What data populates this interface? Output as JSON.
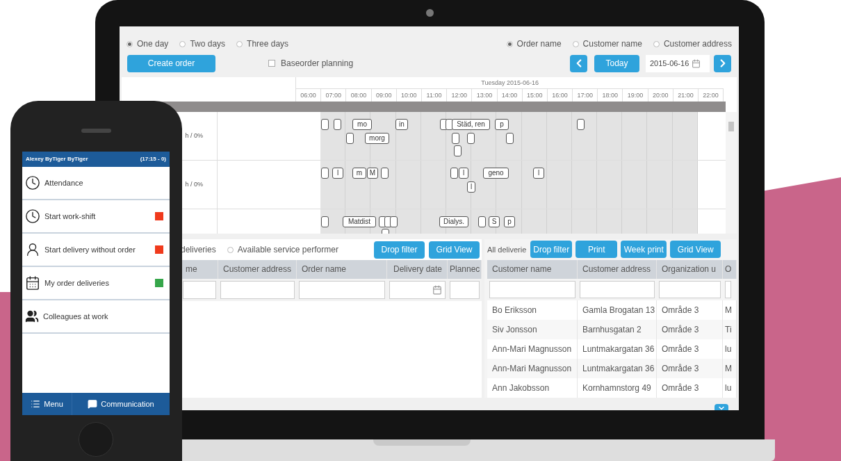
{
  "phone": {
    "header": {
      "user": "Alexey ByTiger ByTiger",
      "shift": "(17:15 - 0)"
    },
    "items": [
      {
        "kind": "clock",
        "label": "Attendance"
      },
      {
        "kind": "clock",
        "label": "Start work-shift",
        "color": "#f03a1c"
      },
      {
        "kind": "person",
        "label": "Start delivery without order",
        "color": "#f03a1c"
      },
      {
        "kind": "calendar",
        "label": "My order deliveries",
        "color": "#36a64a"
      },
      {
        "kind": "people",
        "label": "Colleagues at work"
      }
    ],
    "footer": [
      {
        "kind": "menu",
        "label": "Menu"
      },
      {
        "kind": "chat",
        "label": "Communication"
      }
    ]
  },
  "planner": {
    "view_options": [
      {
        "label": "One day",
        "selected": true
      },
      {
        "label": "Two days",
        "selected": false
      },
      {
        "label": "Three days",
        "selected": false
      }
    ],
    "search_by": [
      {
        "label": "Order name",
        "selected": true
      },
      {
        "label": "Customer name",
        "selected": false
      },
      {
        "label": "Customer address",
        "selected": false
      }
    ],
    "create_button": "Create order",
    "baseorder": {
      "label": "Baseorder planning",
      "checked": false
    },
    "today_button": "Today",
    "date_field": "2015-06-16",
    "timeline": {
      "date": "Tuesday 2015-06-16",
      "hours": [
        "06:00",
        "07:00",
        "08:00",
        "09:00",
        "10:00",
        "11:00",
        "12:00",
        "13:00",
        "14:00",
        "15:00",
        "16:00",
        "17:00",
        "18:00",
        "19:00",
        "20:00",
        "21:00",
        "22:00"
      ]
    },
    "rows": [
      {
        "label": "h / 0%",
        "events": [
          "mo",
          "in",
          "Städ, ren",
          "p",
          "morg"
        ]
      },
      {
        "label": "h / 0%",
        "events": [
          "l",
          "m",
          "M",
          "l",
          "geno",
          "l",
          "l"
        ]
      },
      {
        "events": [
          "Matdist",
          "Dialys.",
          "S",
          "p"
        ]
      }
    ]
  },
  "left_panel": {
    "deliveries_label": "deliveries",
    "radio": {
      "label": "Available service performer",
      "selected": false
    },
    "buttons": [
      "Drop filter",
      "Grid View"
    ],
    "columns": [
      "me",
      "Customer address",
      "Order name",
      "Delivery date",
      "Plannec"
    ]
  },
  "right_panel": {
    "label": "All deliverie",
    "buttons": [
      "Drop filter",
      "Print",
      "Week print",
      "Grid View"
    ],
    "columns": [
      "Customer name",
      "Customer address",
      "Organization u",
      "O"
    ],
    "rows": [
      [
        "Bo Eriksson",
        "Gamla Brogatan 13",
        "Område 3",
        "M"
      ],
      [
        "Siv Jonsson",
        "Barnhusgatan 2",
        "Område 3",
        "Ti"
      ],
      [
        "Ann-Mari Magnusson",
        "Luntmakargatan 36",
        "Område 3",
        "lu"
      ],
      [
        "Ann-Mari Magnusson",
        "Luntmakargatan 36",
        "Område 3",
        "M"
      ],
      [
        "Ann Jakobsson",
        "Kornhamnstorg 49",
        "Område 3",
        "lu"
      ]
    ]
  }
}
